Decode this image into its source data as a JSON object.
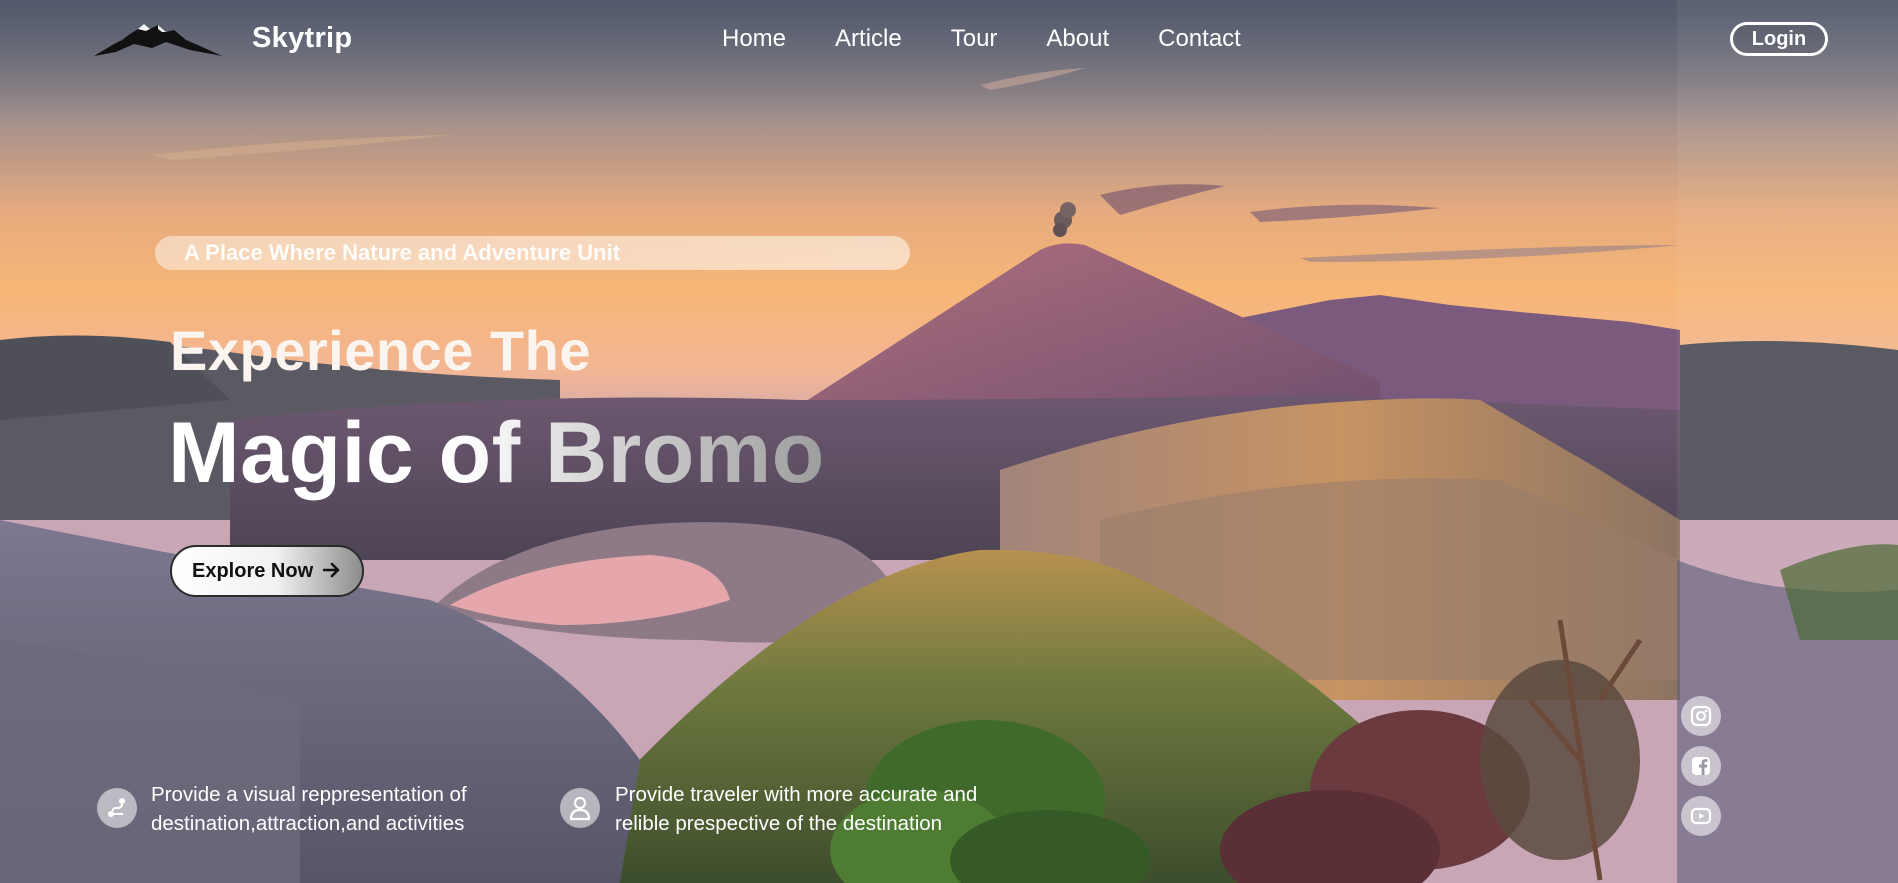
{
  "brand": {
    "name": "Skytrip",
    "logo_icon": "mountain-logo-icon"
  },
  "nav": {
    "items": [
      {
        "label": "Home"
      },
      {
        "label": "Article"
      },
      {
        "label": "Tour"
      },
      {
        "label": "About"
      },
      {
        "label": "Contact"
      }
    ],
    "login_label": "Login"
  },
  "hero": {
    "tagline": "A Place Where Nature and Adventure Unit",
    "heading_line1": "Experience The",
    "heading_line2": "Magic of Bromo",
    "cta_label": "Explore Now",
    "cta_icon": "arrow-right-icon"
  },
  "features": [
    {
      "icon": "route-icon",
      "line1": "Provide a visual reppresentation of",
      "line2": "destination,attraction,and activities"
    },
    {
      "icon": "user-icon",
      "line1": "Provide traveler with more accurate and",
      "line2": "relible prespective of the destination"
    }
  ],
  "social": [
    {
      "icon": "instagram-icon"
    },
    {
      "icon": "facebook-icon"
    },
    {
      "icon": "youtube-icon"
    }
  ],
  "colors": {
    "sky_top": "#6c7384",
    "sky_glow": "#f4b070",
    "text": "#ffffff",
    "cta_text": "#111111"
  }
}
